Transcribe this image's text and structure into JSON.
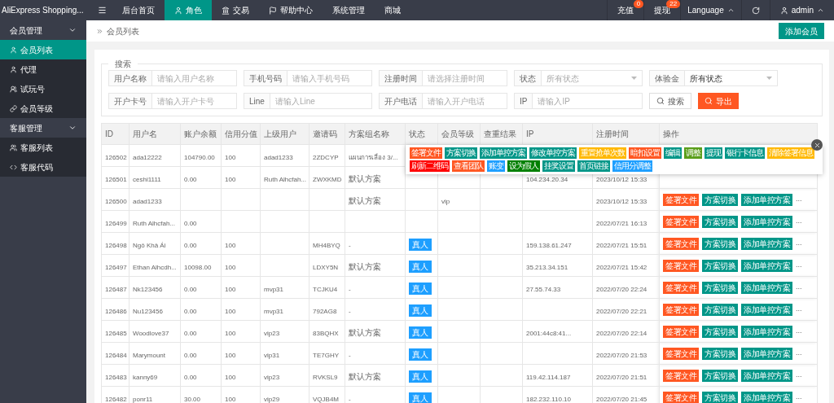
{
  "app": {
    "title": "AliExpress Shopping..."
  },
  "top_nav": {
    "items": [
      {
        "label": "后台首页",
        "selected": false
      },
      {
        "label": "角色",
        "selected": true
      },
      {
        "label": "交易",
        "selected": false
      },
      {
        "label": "帮助中心",
        "selected": false
      },
      {
        "label": "系统管理",
        "selected": false
      },
      {
        "label": "商城",
        "selected": false
      }
    ],
    "right": [
      {
        "label": "充值",
        "badge": "0"
      },
      {
        "label": "提现",
        "badge": "22"
      }
    ],
    "language": "Language",
    "user": "admin"
  },
  "sidebar": {
    "groups": [
      {
        "label": "会员管理",
        "expanded": true,
        "items": [
          {
            "label": "会员列表",
            "selected": true
          },
          {
            "label": "代理",
            "selected": false
          },
          {
            "label": "试玩号",
            "selected": false
          },
          {
            "label": "会员等级",
            "selected": false
          }
        ]
      },
      {
        "label": "客服管理",
        "expanded": true,
        "items": [
          {
            "label": "客服列表",
            "selected": false
          },
          {
            "label": "客服代码",
            "selected": false
          }
        ]
      }
    ]
  },
  "breadcrumb": "会员列表",
  "add_button": "添加会员",
  "search": {
    "legend": "搜索",
    "row_1": [
      {
        "kind": "input",
        "label": "用户名称",
        "placeholder": "请输入用户名称"
      },
      {
        "kind": "input",
        "label": "手机号码",
        "placeholder": "请输入手机号码"
      },
      {
        "kind": "input",
        "label": "注册时间",
        "placeholder": "请选择注册时间"
      },
      {
        "kind": "select",
        "label": "状态",
        "placeholder": "所有状态"
      },
      {
        "kind": "select",
        "label": "体验金",
        "value": "所有状态"
      }
    ],
    "row_2": [
      {
        "kind": "input",
        "label": "开户卡号",
        "placeholder": "请输入开户卡号"
      },
      {
        "kind": "input",
        "label": "Line",
        "placeholder": "请输入Line"
      },
      {
        "kind": "input",
        "label": "开户电话",
        "placeholder": "请输入开户电话"
      },
      {
        "kind": "input",
        "label": "IP",
        "placeholder": "请输入IP"
      }
    ],
    "search_button": "搜索",
    "export_button": "导出"
  },
  "table": {
    "columns": [
      {
        "label": "ID",
        "kind": "text"
      },
      {
        "label": "用户名",
        "kind": "text"
      },
      {
        "label": "账户余额",
        "kind": "text"
      },
      {
        "label": "信用分值",
        "kind": "text"
      },
      {
        "label": "上级用户",
        "kind": "text"
      },
      {
        "label": "邀请码",
        "kind": "text"
      },
      {
        "label": "方案组名称",
        "kind": "text"
      },
      {
        "label": "状态",
        "kind": "tag"
      },
      {
        "label": "会员等级",
        "kind": "text"
      },
      {
        "label": "查重结果",
        "kind": "text"
      },
      {
        "label": "IP",
        "kind": "text"
      },
      {
        "label": "注册时间",
        "kind": "text"
      },
      {
        "label": "操作",
        "kind": "actions"
      }
    ],
    "rows": [
      {
        "cells": [
          "126502",
          "ada12222",
          "104790.00",
          "100",
          "adad1233",
          "2ZDCYP",
          "แผนการเลื่อง 3/...",
          null,
          null,
          null,
          null,
          null
        ]
      },
      {
        "cells": [
          "126501",
          "ceshi1111",
          "0.00",
          "100",
          "Ruth Alhcfah...",
          "ZWXKMD",
          "默认方案",
          null,
          null,
          null,
          "104.234.20.34",
          "2023/10/12 15:33"
        ]
      },
      {
        "cells": [
          "126500",
          "adad1233",
          null,
          null,
          null,
          null,
          "默认方案",
          null,
          "vip",
          null,
          null,
          "2023/10/12 15:33"
        ],
        "actions": [
          {
            "label": "签署文件",
            "color": "#ff5722"
          },
          {
            "label": "方案切换",
            "color": "#009688"
          },
          {
            "label": "添加单控方案",
            "color": "#009688"
          }
        ],
        "more": "..."
      },
      {
        "cells": [
          "126499",
          "Ruth Alhcfah...",
          "0.00",
          null,
          null,
          null,
          null,
          null,
          null,
          null,
          null,
          "2022/07/21 16:13"
        ],
        "actions": [
          {
            "label": "签署文件",
            "color": "#ff5722"
          },
          {
            "label": "方案切换",
            "color": "#009688"
          },
          {
            "label": "添加单控方案",
            "color": "#009688"
          }
        ],
        "more": "..."
      },
      {
        "cells": [
          "126498",
          "Ngô Khả Ái",
          "0.00",
          "100",
          null,
          "MH4BYQ",
          "-",
          "真人",
          null,
          null,
          "159.138.61.247",
          "2022/07/21 15:51"
        ],
        "actions": [
          {
            "label": "签署文件",
            "color": "#ff5722"
          },
          {
            "label": "方案切换",
            "color": "#009688"
          },
          {
            "label": "添加单控方案",
            "color": "#009688"
          }
        ],
        "more": "..."
      },
      {
        "cells": [
          "126497",
          "Ethan Alhcdh...",
          "10098.00",
          "100",
          null,
          "LDXY5N",
          "默认方案",
          "真人",
          null,
          null,
          "35.213.34.151",
          "2022/07/21 15:42"
        ],
        "actions": [
          {
            "label": "签署文件",
            "color": "#ff5722"
          },
          {
            "label": "方案切换",
            "color": "#009688"
          },
          {
            "label": "添加单控方案",
            "color": "#009688"
          }
        ],
        "more": "..."
      },
      {
        "cells": [
          "126487",
          "Nk123456",
          "0.00",
          "100",
          "mvp31",
          "TCJKU4",
          "-",
          "真人",
          null,
          null,
          "27.55.74.33",
          "2022/07/20 22:24"
        ],
        "actions": [
          {
            "label": "签署文件",
            "color": "#ff5722"
          },
          {
            "label": "方案切换",
            "color": "#009688"
          },
          {
            "label": "添加单控方案",
            "color": "#009688"
          }
        ],
        "more": "..."
      },
      {
        "cells": [
          "126486",
          "Nu123456",
          "0.00",
          "100",
          "mvp31",
          "792AG8",
          "-",
          "真人",
          null,
          null,
          null,
          "2022/07/20 22:21"
        ],
        "actions": [
          {
            "label": "签署文件",
            "color": "#ff5722"
          },
          {
            "label": "方案切换",
            "color": "#009688"
          },
          {
            "label": "添加单控方案",
            "color": "#009688"
          }
        ],
        "more": "..."
      },
      {
        "cells": [
          "126485",
          "Woodlove37",
          "0.00",
          "100",
          "vip23",
          "83BQHX",
          "默认方案",
          "真人",
          null,
          null,
          "2001:44c8:41...",
          "2022/07/20 22:14"
        ],
        "actions": [
          {
            "label": "签署文件",
            "color": "#ff5722"
          },
          {
            "label": "方案切换",
            "color": "#009688"
          },
          {
            "label": "添加单控方案",
            "color": "#009688"
          }
        ],
        "more": "..."
      },
      {
        "cells": [
          "126484",
          "Marymount",
          "0.00",
          "100",
          "vip31",
          "TE7GHY",
          "-",
          "真人",
          null,
          null,
          null,
          "2022/07/20 21:53"
        ],
        "actions": [
          {
            "label": "签署文件",
            "color": "#ff5722"
          },
          {
            "label": "方案切换",
            "color": "#009688"
          },
          {
            "label": "添加单控方案",
            "color": "#009688"
          }
        ],
        "more": "..."
      },
      {
        "cells": [
          "126483",
          "kanny69",
          "0.00",
          "100",
          "vip23",
          "RVKSL9",
          "默认方案",
          "真人",
          null,
          null,
          "119.42.114.187",
          "2022/07/20 21:51"
        ],
        "actions": [
          {
            "label": "签署文件",
            "color": "#ff5722"
          },
          {
            "label": "方案切换",
            "color": "#009688"
          },
          {
            "label": "添加单控方案",
            "color": "#009688"
          }
        ],
        "more": "..."
      },
      {
        "cells": [
          "126482",
          "ponr11",
          "30.00",
          "100",
          "vip29",
          "VQJB4M",
          "-",
          "真人",
          null,
          null,
          "182.232.110.10",
          "2022/07/20 21:45"
        ],
        "actions": [
          {
            "label": "签署文件",
            "color": "#ff5722"
          },
          {
            "label": "方案切换",
            "color": "#009688"
          },
          {
            "label": "添加单控方案",
            "color": "#009688"
          }
        ],
        "more": "..."
      }
    ]
  },
  "action_menu": {
    "items": [
      {
        "label": "签署文件",
        "color": "#ff5722"
      },
      {
        "label": "方案切换",
        "color": "#009688"
      },
      {
        "label": "添加单控方案",
        "color": "#009688"
      },
      {
        "label": "修改单控方案",
        "color": "#009688"
      },
      {
        "label": "重置抢单次数",
        "color": "#ffb800"
      },
      {
        "label": "暗扣设置",
        "color": "#ff5722"
      },
      {
        "label": "编辑",
        "color": "#009688"
      },
      {
        "label": "调整",
        "color": "#5a9e1a"
      },
      {
        "label": "提现",
        "color": "#009688"
      },
      {
        "label": "银行卡信息",
        "color": "#009688"
      },
      {
        "label": "清除签署信息",
        "color": "#ffb800"
      },
      {
        "label": "刷新二维码",
        "color": "#ff0000"
      },
      {
        "label": "查看团队",
        "color": "#ff5722"
      },
      {
        "label": "账变",
        "color": "#1e9fff"
      },
      {
        "label": "设为假人",
        "color": "#008000"
      },
      {
        "label": "挂奖设置",
        "color": "#009688"
      },
      {
        "label": "首页链接",
        "color": "#009688"
      },
      {
        "label": "信用分调整",
        "color": "#1e9fff"
      }
    ]
  }
}
